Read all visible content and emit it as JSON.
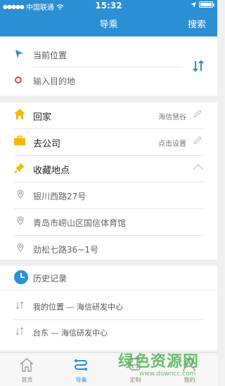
{
  "status_bar": {
    "carrier": "中国联通",
    "time": "15:32"
  },
  "header": {
    "title": "导乘",
    "search_label": "搜索"
  },
  "route": {
    "start_text": "当前位置",
    "destination_placeholder": "输入目的地"
  },
  "places": {
    "home": {
      "label": "回家",
      "value": "海信慧谷"
    },
    "company": {
      "label": "去公司",
      "value": "点击设置"
    },
    "favorites_label": "收藏地点",
    "favorites": [
      "银川西路27号",
      "青岛市崂山区国信体育馆",
      "劲松七路36~1号"
    ]
  },
  "history": {
    "title": "历史记录",
    "items": [
      "我的位置 — 海信研发中心",
      "台东 — 海信研发中心"
    ]
  },
  "tabs": [
    {
      "label": "首页",
      "icon": "home-icon"
    },
    {
      "label": "导乘",
      "icon": "route-icon"
    },
    {
      "label": "定制",
      "icon": "bus-icon"
    },
    {
      "label": "我的",
      "icon": "user-icon"
    }
  ],
  "watermark": {
    "text": "绿色资源网",
    "url": "www.downcc.com"
  },
  "colors": {
    "accent": "#2b8fd4",
    "home_icon": "#f5b800",
    "destination": "#e0454a"
  }
}
